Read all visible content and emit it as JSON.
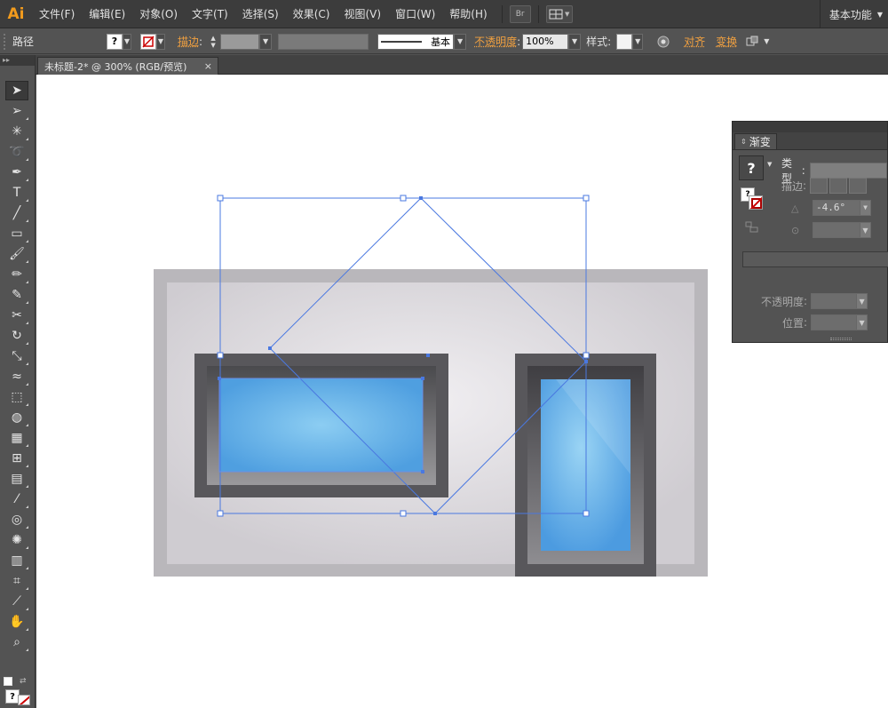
{
  "app": {
    "logo": "Ai",
    "menu": [
      "文件(F)",
      "编辑(E)",
      "对象(O)",
      "文字(T)",
      "选择(S)",
      "效果(C)",
      "视图(V)",
      "窗口(W)",
      "帮助(H)"
    ],
    "bridge_label": "Br",
    "workspace": "基本功能"
  },
  "control_bar": {
    "object_type": "路径",
    "fill_glyph": "?",
    "stroke_label": "描边",
    "stroke_style": "基本",
    "opacity_label": "不透明度",
    "opacity_value": "100%",
    "style_label": "样式",
    "align_label": "对齐",
    "transform_label": "变换"
  },
  "document_tab": {
    "title": "未标题-2* @ 300% (RGB/预览)",
    "close_glyph": "×"
  },
  "tools": [
    "selection-tool",
    "direct-selection-tool",
    "magic-wand-tool",
    "lasso-tool",
    "pen-tool",
    "type-tool",
    "line-tool",
    "rectangle-tool",
    "paintbrush-tool",
    "pencil-tool",
    "blob-brush-tool",
    "scissors-tool",
    "rotate-tool",
    "scale-tool",
    "warp-tool",
    "free-transform-tool",
    "shape-builder-tool",
    "perspective-grid-tool",
    "mesh-tool",
    "gradient-tool",
    "eyedropper-tool",
    "blend-tool",
    "symbol-sprayer-tool",
    "column-graph-tool",
    "artboard-tool",
    "slice-tool",
    "hand-tool",
    "zoom-tool"
  ],
  "gradient_panel": {
    "tab_label": "渐变",
    "fill_glyph": "?",
    "type_label": "类型",
    "stroke_label": "描边",
    "angle_value": "-4.6°",
    "opacity_label": "不透明度",
    "location_label": "位置"
  },
  "colors": {
    "accent_orange": "#f29b1d",
    "selection_blue": "#4a78e0",
    "screen_blue": "#58a7e3"
  }
}
